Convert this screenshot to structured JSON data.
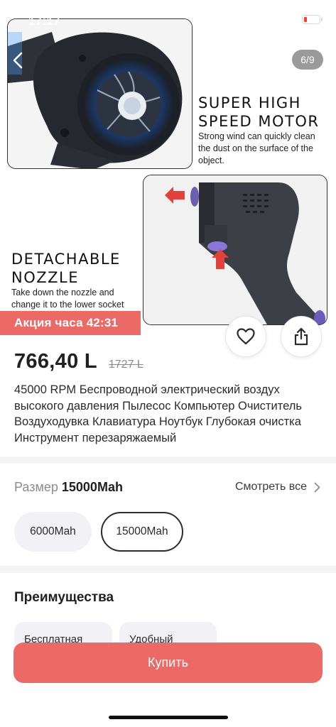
{
  "status_bar": {
    "time": "17:17"
  },
  "gallery": {
    "counter": "6/9",
    "panel1_title_line1": "SUPER HIGH",
    "panel1_title_line2": "SPEED MOTOR",
    "panel1_subtitle_line1": "Strong wind can quickly clean",
    "panel1_subtitle_line2": "the dust on the surface of the",
    "panel1_subtitle_line3": "object.",
    "panel2_title_line1": "DETACHABLE",
    "panel2_title_line2": "NOZZLE",
    "panel2_subtitle_line1": "Take down the nozzle and",
    "panel2_subtitle_line2": "change it to the lower socket"
  },
  "promo": {
    "text": "Акция часа 42:31"
  },
  "product": {
    "price": "766,40 L",
    "old_price": "1727 L",
    "title": "45000 RPM Беспроводной электрический воздух высокого давления Пылесос Компьютер Очиститель Воздуходувка Клавиатура Ноутбук Глубокая очистка Инструмент перезаряжаемый"
  },
  "size": {
    "label": "Размер",
    "selected": "15000Mah",
    "see_all": "Смотреть все",
    "options": [
      "6000Mah",
      "15000Mah"
    ]
  },
  "advantages": {
    "title": "Преимущества",
    "items": [
      "Бесплатная",
      "Удобный"
    ]
  },
  "buy_button": {
    "label": "Купить"
  },
  "colors": {
    "accent": "#ec6a66",
    "text": "#1f1f24",
    "chip_bg": "#f2f2f6",
    "muted": "#8a8a96"
  }
}
